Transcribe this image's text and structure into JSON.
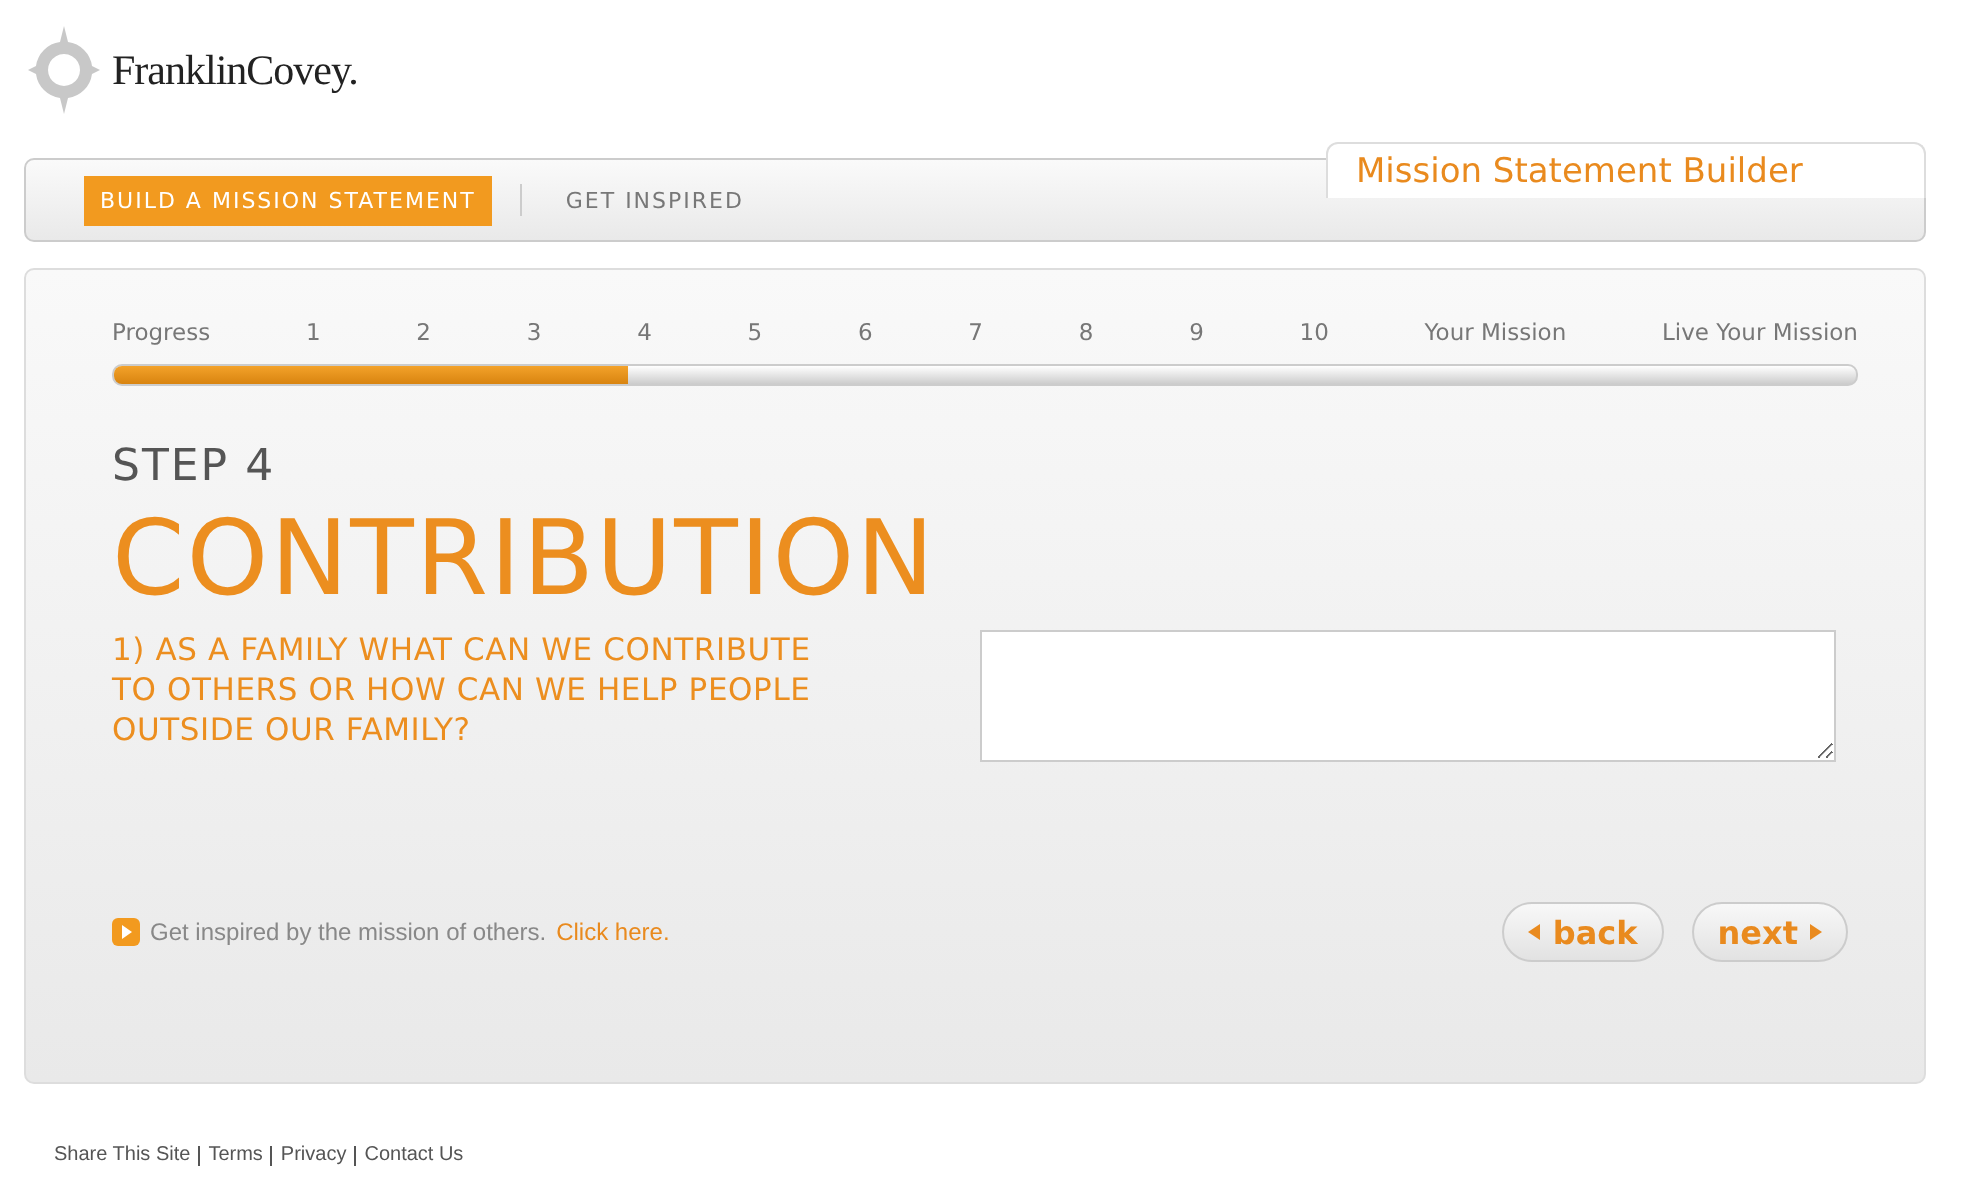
{
  "logo": {
    "text": "FranklinCovey."
  },
  "nav": {
    "tabs": [
      {
        "label": "BUILD A MISSION STATEMENT",
        "selected": true
      },
      {
        "label": "GET INSPIRED",
        "selected": false
      }
    ],
    "title": "Mission Statement Builder"
  },
  "progress": {
    "label": "Progress",
    "steps": [
      "1",
      "2",
      "3",
      "4",
      "5",
      "6",
      "7",
      "8",
      "9",
      "10",
      "Your Mission",
      "Live Your Mission"
    ],
    "level": 0.295
  },
  "step": {
    "number": "STEP 4",
    "title": "CONTRIBUTION",
    "question": "1) AS A FAMILY WHAT CAN WE CONTRIBUTE TO OTHERS OR HOW CAN WE HELP PEOPLE OUTSIDE OUR FAMILY?"
  },
  "inspire": {
    "text": "Get inspired by the mission of others.",
    "link": "Click here."
  },
  "buttons": [
    {
      "kind": "back",
      "label": "back"
    },
    {
      "kind": "next",
      "label": "next"
    }
  ],
  "footer": [
    "Share This Site",
    "Terms",
    "Privacy",
    "Contact Us"
  ]
}
